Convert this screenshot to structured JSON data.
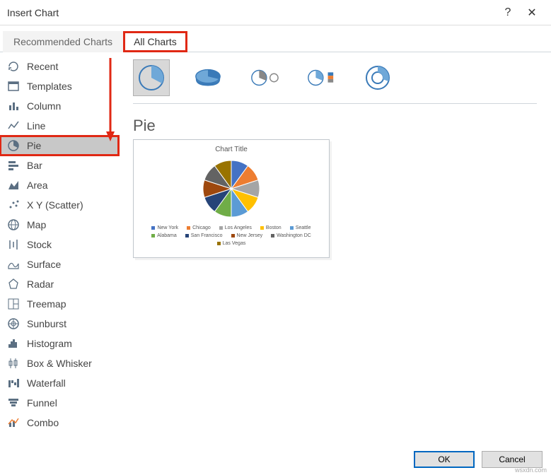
{
  "window": {
    "title": "Insert Chart"
  },
  "tabs": {
    "recommended": "Recommended Charts",
    "all": "All Charts"
  },
  "sidebar": {
    "items": [
      {
        "label": "Recent"
      },
      {
        "label": "Templates"
      },
      {
        "label": "Column"
      },
      {
        "label": "Line"
      },
      {
        "label": "Pie"
      },
      {
        "label": "Bar"
      },
      {
        "label": "Area"
      },
      {
        "label": "X Y (Scatter)"
      },
      {
        "label": "Map"
      },
      {
        "label": "Stock"
      },
      {
        "label": "Surface"
      },
      {
        "label": "Radar"
      },
      {
        "label": "Treemap"
      },
      {
        "label": "Sunburst"
      },
      {
        "label": "Histogram"
      },
      {
        "label": "Box & Whisker"
      },
      {
        "label": "Waterfall"
      },
      {
        "label": "Funnel"
      },
      {
        "label": "Combo"
      }
    ]
  },
  "main": {
    "subtitle": "Pie",
    "preview_title": "Chart Title",
    "legend": [
      "New York",
      "Chicago",
      "Los Angeles",
      "Boston",
      "Seattle",
      "Alabama",
      "San Francisco",
      "New Jersey",
      "Washington DC",
      "Las Vegas"
    ]
  },
  "buttons": {
    "ok": "OK",
    "cancel": "Cancel"
  },
  "watermark": "wsxdn.com",
  "chart_data": {
    "type": "pie",
    "title": "Chart Title",
    "categories": [
      "New York",
      "Chicago",
      "Los Angeles",
      "Boston",
      "Seattle",
      "Alabama",
      "San Francisco",
      "New Jersey",
      "Washington DC",
      "Las Vegas"
    ],
    "values": [
      10,
      10,
      10,
      10,
      10,
      10,
      10,
      10,
      10,
      10
    ],
    "colors": [
      "#4472c4",
      "#ed7d31",
      "#a5a5a5",
      "#ffc000",
      "#5b9bd5",
      "#70ad47",
      "#264478",
      "#9e480e",
      "#636363",
      "#997300"
    ]
  }
}
